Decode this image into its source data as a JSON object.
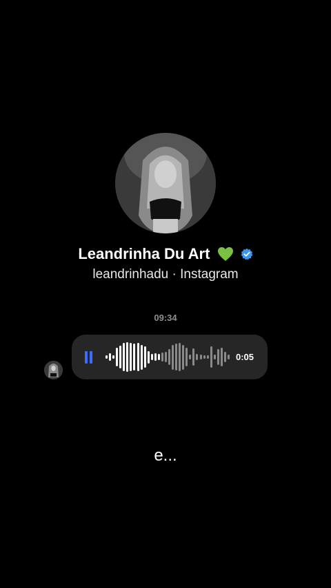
{
  "profile": {
    "name": "Leandrinha Du Art",
    "name_emoji": "💚",
    "verified_icon": "verified-badge-icon",
    "verified_color": "#3897f0",
    "heart_color": "#7ac142",
    "subtitle": "leandrinhadu · Instagram"
  },
  "chat": {
    "timestamp": "09:34",
    "voice_message": {
      "duration": "0:05",
      "state": "playing",
      "control_icon": "pause-icon",
      "accent_color": "#3d6cff",
      "played_fraction": 0.45,
      "waveform_levels": [
        0.1,
        0.25,
        0.12,
        0.6,
        0.75,
        0.9,
        0.95,
        0.92,
        0.85,
        0.9,
        0.8,
        0.7,
        0.4,
        0.2,
        0.25,
        0.22,
        0.3,
        0.35,
        0.5,
        0.8,
        0.85,
        0.9,
        0.8,
        0.6,
        0.15,
        0.55,
        0.2,
        0.15,
        0.12,
        0.1,
        0.7,
        0.15,
        0.5,
        0.6,
        0.35,
        0.15
      ]
    }
  },
  "caption": "e..."
}
